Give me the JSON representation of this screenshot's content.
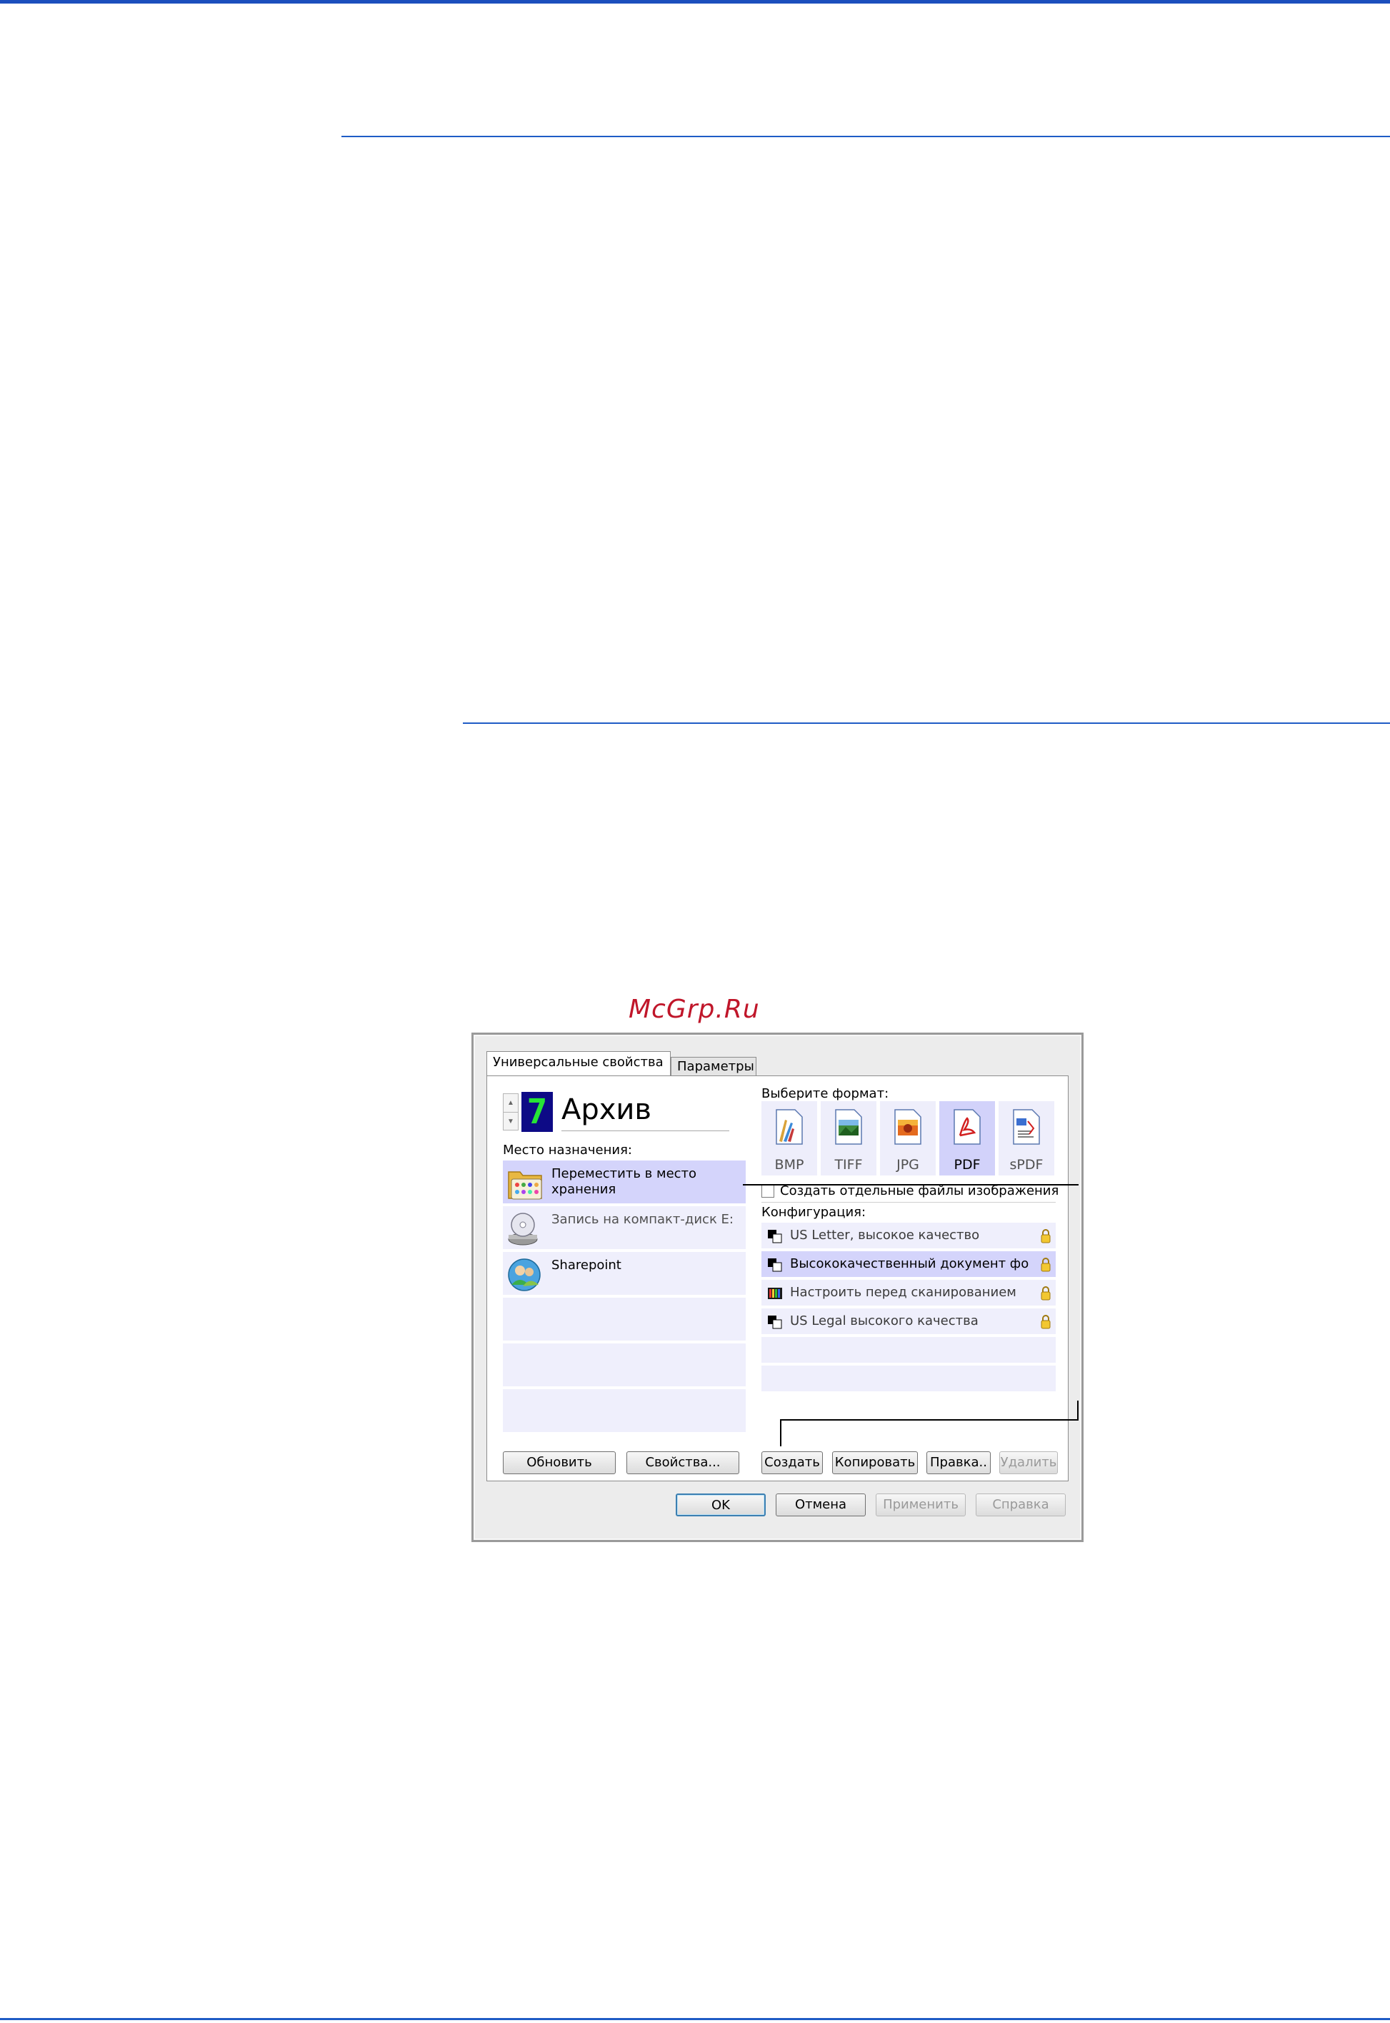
{
  "watermark": "McGrp.Ru",
  "dialog": {
    "tabs": [
      "Универсальные свойства",
      "Параметры"
    ],
    "profile": {
      "number": "7",
      "name": "Архив"
    },
    "destination": {
      "label": "Место назначения:",
      "items": [
        {
          "label": "Переместить в место хранения",
          "icon": "folder-storage-icon",
          "selected": true
        },
        {
          "label": "Запись на компакт-диск  E:",
          "icon": "cd-burner-icon",
          "selected": false
        },
        {
          "label": "Sharepoint",
          "icon": "sharepoint-users-icon",
          "selected": false
        }
      ],
      "refresh_label": "Обновить",
      "properties_label": "Свойства..."
    },
    "format": {
      "label": "Выберите формат:",
      "options": [
        {
          "name": "BMP",
          "selected": false
        },
        {
          "name": "TIFF",
          "selected": false
        },
        {
          "name": "JPG",
          "selected": false
        },
        {
          "name": "PDF",
          "selected": true
        },
        {
          "name": "sPDF",
          "selected": false
        }
      ],
      "separate_files_label": "Создать отдельные файлы изображения",
      "separate_files_checked": false
    },
    "configuration": {
      "label": "Конфигурация:",
      "items": [
        {
          "label": "US Letter, высокое качество",
          "selected": false,
          "locked": true
        },
        {
          "label": "Высококачественный документ фор...",
          "selected": true,
          "locked": true
        },
        {
          "label": "Настроить перед сканированием",
          "selected": false,
          "locked": true
        },
        {
          "label": "US Legal высокого качества",
          "selected": false,
          "locked": true
        }
      ],
      "create_label": "Создать",
      "copy_label": "Копировать",
      "edit_label": "Правка..",
      "delete_label": "Удалить"
    },
    "footer": {
      "ok_label": "OK",
      "cancel_label": "Отмена",
      "apply_label": "Применить",
      "help_label": "Справка"
    }
  },
  "colors": {
    "accent_rule": "#1f5cc6",
    "selected_bg": "#d4d4fb",
    "list_bg": "#efeffc",
    "watermark": "#c0162a"
  }
}
